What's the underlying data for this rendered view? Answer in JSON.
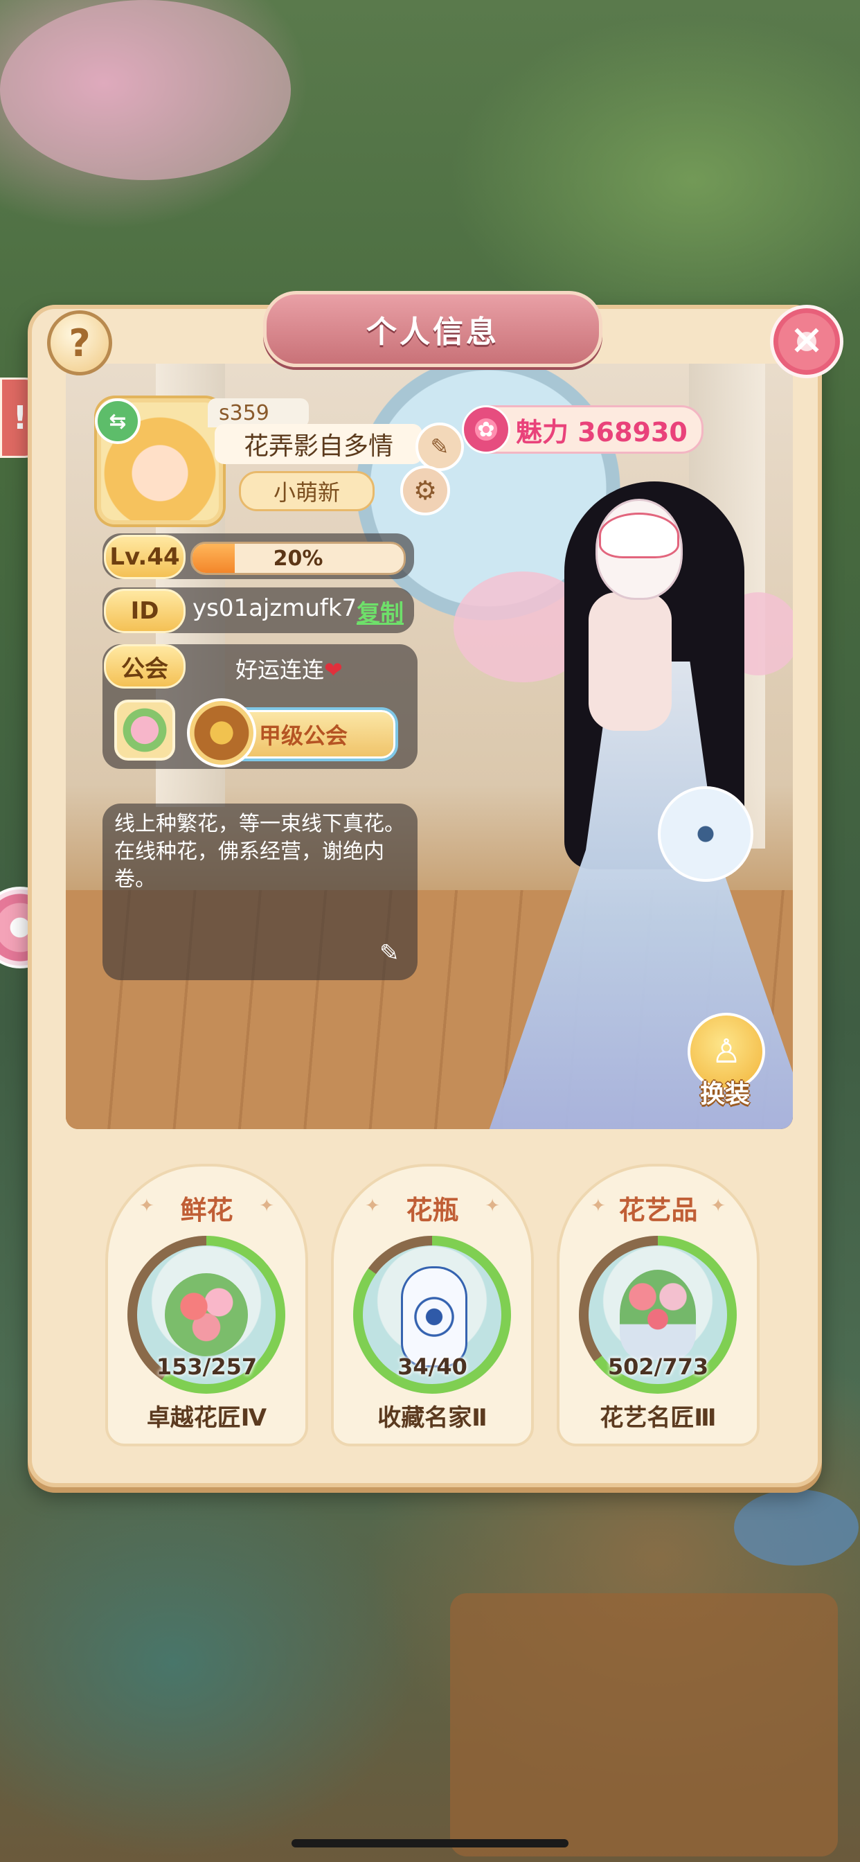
{
  "panel": {
    "title": "个人信息",
    "help_label": "?",
    "close_label": "✕"
  },
  "profile": {
    "vip_tag": "s359",
    "nickname": "花弄影自多情",
    "title_tag": "小萌新",
    "charm_label": "魅力 368930",
    "level_label": "Lv.44",
    "level_progress_text": "20%",
    "level_progress": 0.2,
    "id_label": "ID",
    "id_value": "ys01ajzmufk7",
    "copy_label": "复制",
    "guild_label": "公会",
    "guild_name": "好运连连",
    "guild_rank": "甲级公会",
    "bio": "线上种繁花，等一束线下真花。在线种花，佛系经营，谢绝内卷。"
  },
  "outfit_button": {
    "label": "换装"
  },
  "collections": [
    {
      "title": "鲜花",
      "progress_text": "153/257",
      "current": 153,
      "total": 257,
      "rank": "卓越花匠Ⅳ"
    },
    {
      "title": "花瓶",
      "progress_text": "34/40",
      "current": 34,
      "total": 40,
      "rank": "收藏名家Ⅱ"
    },
    {
      "title": "花艺品",
      "progress_text": "502/773",
      "current": 502,
      "total": 773,
      "rank": "花艺名匠Ⅲ"
    }
  ],
  "icons": {
    "help": "question-icon",
    "close": "close-icon",
    "side_alert": "alert-icon",
    "side_flower": "flower-icon",
    "swap": "swap-icon",
    "edit": "pencil-icon",
    "settings": "gear-icon",
    "charm": "rose-icon",
    "bio_edit": "pencil-icon",
    "outfit": "dress-form-icon"
  },
  "colors": {
    "accent": "#e9427a",
    "progress_fill": "#7fcf52",
    "level_fill": "#f3862a",
    "copy_link": "#6ee06a"
  }
}
